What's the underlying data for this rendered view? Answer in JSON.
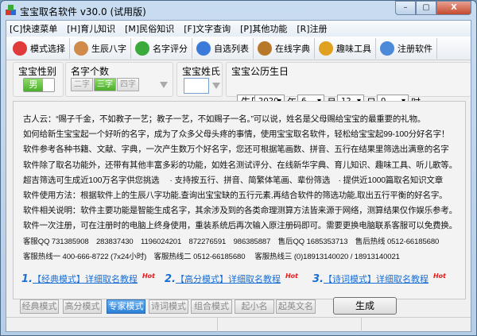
{
  "window": {
    "title": "宝宝取名软件 v30.0 (试用版)",
    "min": "–",
    "max": "▢",
    "close": "X"
  },
  "menu": [
    "[C]快速菜单",
    "[H]育儿知识",
    "[M]民俗知识",
    "[F]文字查询",
    "[P]其他功能",
    "[R]注册"
  ],
  "toolbar": [
    {
      "label": "模式选择",
      "icon": "heart-icon",
      "color": "#e03a3a"
    },
    {
      "label": "生辰八字",
      "icon": "people-icon",
      "color": "#d08a4a"
    },
    {
      "label": "名字评分",
      "icon": "arrow-right-icon",
      "color": "#3aaa3a"
    },
    {
      "label": "自选列表",
      "icon": "globe-icon",
      "color": "#3a7ad8"
    },
    {
      "label": "在线字典",
      "icon": "graduate-icon",
      "color": "#b8782a"
    },
    {
      "label": "趣味工具",
      "icon": "windows-icon",
      "color": "#e0a020"
    },
    {
      "label": "注册软件",
      "icon": "monitor-icon",
      "color": "#4a8ad8"
    }
  ],
  "options": {
    "gender": {
      "label": "宝宝性别",
      "value": "男"
    },
    "name_count": {
      "label": "名字个数",
      "options": [
        "二字",
        "三字",
        "四字"
      ],
      "selected": "三字"
    },
    "surname": {
      "label": "宝宝姓氏",
      "value": ""
    },
    "birthday": {
      "label": "宝宝公历生日",
      "type": "生日",
      "year": "2020",
      "year_unit": "年",
      "month": "6",
      "month_unit": "月",
      "day": "12",
      "day_unit": "日",
      "hour": "0",
      "hour_unit": "时"
    }
  },
  "content": {
    "lines": [
      "古人云：“赐子千金，不如教子一艺；教子一艺，不如赐子一名。”可以说，姓名是父母赐给宝宝的最重要的礼物。",
      "如何给新生宝宝起一个好听的名字，成为了众多父母头疼的事情，使用宝宝取名软件，轻松给宝宝起99-100分好名字！",
      "软件参考各种书籍、文献、字典，一次产生数万个好名字，您还可根据笔画数、拼音、五行在结果里筛选出满意的名字",
      "软件除了取名功能外，还带有其他丰富多彩的功能，如姓名测试评分、在线新华字典、育儿知识、趣味工具、听儿歌等。",
      "超吉筛选可生成近100万名字供您挑选　 · 支持按五行、拼音、简繁体笔画、辈份筛选　· 提供近1000篇取名知识文章",
      "软件使用方法：根据软件上的生辰八字功能,查询出宝宝缺的五行元素,再结合软件的筛选功能,取出五行平衡的好名字。",
      "软件相关说明：软件主要功能是智能生成名字，其余涉及到的各类命理测算方法皆来源于网络，测算结果仅作娱乐参考。",
      "软件一次注册，可在注册时的电脑上终身使用，重装系统后再次输入原注册码即可。需要更换电脑联系客服可以免费换。",
      "客服QQ 731385908　283837430　1196024201　872276591　986385887　售后QQ 1685353713　售后热线 0512-66185680",
      "客服热线一 400-666-8722 (7x24小时)　客服热线二 0512-66185680　 客服热线三 (0)18913140020 / 18913140021"
    ],
    "links": [
      {
        "num": "1.",
        "text": "【经典模式】详细取名教程",
        "badge": "Hot"
      },
      {
        "num": "2.",
        "text": "【高分模式】详细取名教程",
        "badge": "Hot"
      },
      {
        "num": "3.",
        "text": "【诗词模式】详细取名教程",
        "badge": "Hot"
      }
    ]
  },
  "modes": [
    "经典模式",
    "高分模式",
    "专家模式",
    "诗词模式",
    "组合模式",
    "起小名",
    "起英文名"
  ],
  "selected_mode": "专家模式",
  "generate": "生成"
}
